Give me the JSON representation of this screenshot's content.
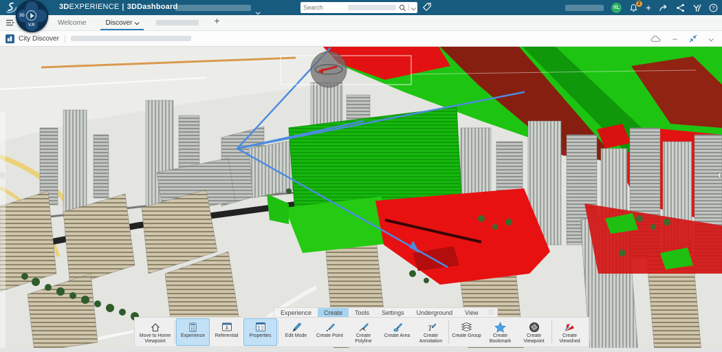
{
  "colors": {
    "topbar_bg": "#175b7e",
    "accent_blue": "#2e7cb5",
    "active_tab_bg": "#a6d3ef",
    "active_button_bg": "#c3e1f6",
    "active_button_border": "#86bde4",
    "viewshed_visible_green": "#1ec412",
    "viewshed_hidden_red": "#e31212",
    "viewshed_ray_blue": "#4d8be0",
    "avatar_green": "#2fae68",
    "badge_orange": "#f09d2e"
  },
  "top_bar": {
    "brand_bold": "3D",
    "brand_rest": "EXPERIENCE",
    "divider": "|",
    "app_name": "3DDashboard",
    "search": {
      "placeholder": "Search",
      "icons": [
        "search-icon",
        "chevron-down-icon"
      ]
    },
    "tag_icon": "tag-icon",
    "user": {
      "initials": "YL"
    },
    "notifications": {
      "icon": "bell-icon",
      "count": "2"
    },
    "action_icons": [
      "add-icon",
      "share-arrow-icon",
      "share-nodes-icon",
      "swym-icon",
      "help-icon"
    ]
  },
  "compass": {
    "left_label": "3D",
    "bottom_label": "V.R",
    "center_icon": "play-icon"
  },
  "tab_bar": {
    "menu_icon": "hamburger-icon",
    "tabs": [
      {
        "label": "Welcome",
        "active": false
      },
      {
        "label": "Discover",
        "active": true
      }
    ],
    "add_label": "+"
  },
  "widget_header": {
    "app_icon": "city-discover-app-icon",
    "title": "City Discover",
    "right_icons": [
      "cloud-icon",
      "minimize-icon",
      "resize-icon",
      "chevron-down-icon"
    ],
    "minimize_glyph": "–"
  },
  "viewport": {
    "left_expander": "›",
    "right_expander": "‹",
    "overlays": [
      "viewshed-visible-green",
      "viewshed-hidden-red",
      "viewshed-rays-blue",
      "navigation-sphere",
      "selection-rectangle"
    ]
  },
  "bottom_toolbar": {
    "tabs": [
      {
        "label": "Experience",
        "active": false
      },
      {
        "label": "Create",
        "active": true
      },
      {
        "label": "Tools",
        "active": false
      },
      {
        "label": "Settings",
        "active": false
      },
      {
        "label": "Underground",
        "active": false
      },
      {
        "label": "View",
        "active": false
      }
    ],
    "favorite_icon": "heart-icon",
    "buttons": [
      {
        "label": "Move to Home Viewpoint",
        "icon": "home-icon",
        "active": false
      },
      {
        "label": "Experience",
        "icon": "experience-tree-icon",
        "active": true
      },
      {
        "label": "Referential",
        "icon": "referential-icon",
        "active": false
      },
      {
        "label": "Properties",
        "icon": "properties-icon",
        "active": true
      },
      {
        "label": "Edit Mode",
        "icon": "pencil-icon",
        "active": false
      },
      {
        "label": "Create Point",
        "icon": "pencil-point-icon",
        "active": false
      },
      {
        "label": "Create Polyline",
        "icon": "pencil-polyline-icon",
        "active": false
      },
      {
        "label": "Create Area",
        "icon": "pencil-area-icon",
        "active": false
      },
      {
        "label": "Create Annotation",
        "icon": "annotation-icon",
        "active": false
      },
      {
        "label": "Create Group",
        "icon": "layers-icon",
        "active": false
      },
      {
        "label": "Create Bookmark",
        "icon": "star-icon",
        "active": false
      },
      {
        "label": "Create Viewpoint",
        "icon": "shutter-icon",
        "active": false
      },
      {
        "label": "Create Viewshed",
        "icon": "viewshed-fan-icon",
        "active": false
      }
    ]
  }
}
